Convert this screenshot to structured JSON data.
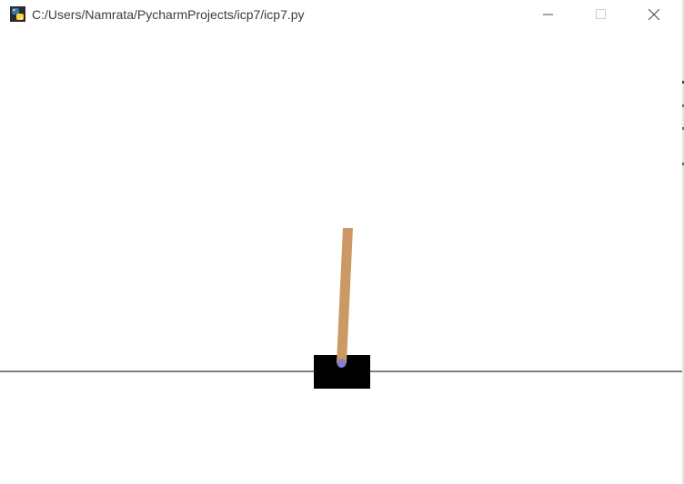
{
  "window": {
    "title": "C:/Users/Namrata/PycharmProjects/icp7/icp7.py",
    "app_icon": "python-icon",
    "controls": {
      "minimize_icon": "minimize-icon",
      "maximize_icon": "maximize-icon",
      "close_icon": "close-icon"
    }
  },
  "scene": {
    "track_color": "#000000",
    "cart_color": "#000000",
    "pole_color": "#cc9966",
    "axle_color": "#8080cc",
    "background_color": "#ffffff"
  }
}
